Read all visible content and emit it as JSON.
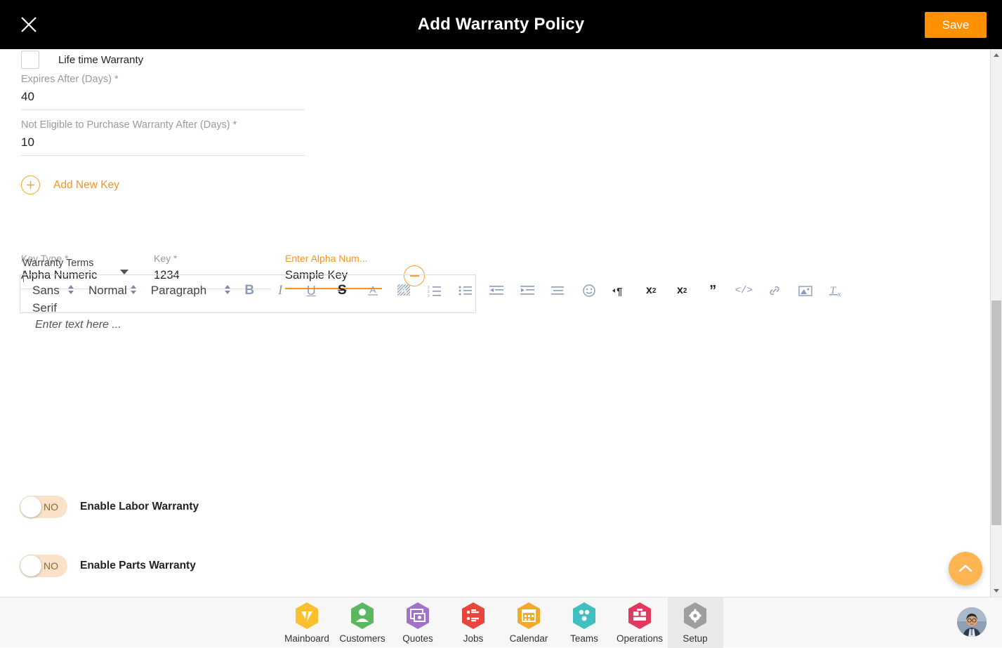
{
  "header": {
    "title": "Add Warranty Policy",
    "close_icon": "close-icon",
    "save_label": "Save"
  },
  "form": {
    "lifetime_warranty": {
      "label": "Life time Warranty",
      "checked": false
    },
    "expires_after": {
      "label": "Expires After (Days) *",
      "value": "40"
    },
    "not_eligible_after": {
      "label": "Not Eligible to Purchase Warranty After (Days) *",
      "value": "10"
    },
    "add_new_key": {
      "label": "Add New Key",
      "icon": "plus-circle-icon"
    },
    "key_row": {
      "key_type": {
        "label": "Key Type *",
        "value": "Alpha Numeric",
        "caret_icon": "chevron-down-icon"
      },
      "key": {
        "label": "Key *",
        "value": "1234"
      },
      "alpha": {
        "label": "Enter Alpha Num...",
        "value": "Sample Key"
      },
      "remove_icon": "minus-circle-icon"
    },
    "warranty_terms": {
      "label": "Warranty Terms",
      "placeholder": "Enter text here ...",
      "toolbar": {
        "font_family": "Sans Serif",
        "font_size": "Normal",
        "block_format": "Paragraph",
        "buttons": [
          {
            "name": "bold-icon",
            "glyph": "B",
            "style": "bold-g"
          },
          {
            "name": "italic-icon",
            "glyph": "I",
            "style": "italic-g"
          },
          {
            "name": "underline-icon",
            "glyph": "U",
            "style": "underline-g"
          },
          {
            "name": "strikethrough-icon",
            "glyph": "S",
            "style": "strike-g"
          },
          {
            "name": "text-color-icon",
            "glyph": "A",
            "style": "color-g"
          },
          {
            "name": "background-color-icon",
            "glyph": "A",
            "style": "bg-g"
          },
          {
            "name": "ordered-list-icon",
            "glyph": "",
            "style": "svg-g"
          },
          {
            "name": "bullet-list-icon",
            "glyph": "",
            "style": "svg-g"
          },
          {
            "name": "outdent-icon",
            "glyph": "",
            "style": "svg-g"
          },
          {
            "name": "indent-icon",
            "glyph": "",
            "style": "svg-g"
          },
          {
            "name": "align-icon",
            "glyph": "",
            "style": "svg-g"
          },
          {
            "name": "emoji-icon",
            "glyph": "",
            "style": "svg-g"
          },
          {
            "name": "text-direction-icon",
            "glyph": "",
            "style": "svg-g"
          },
          {
            "name": "subscript-icon",
            "glyph": "",
            "style": "svg-g"
          },
          {
            "name": "superscript-icon",
            "glyph": "",
            "style": "svg-g"
          },
          {
            "name": "blockquote-icon",
            "glyph": "",
            "style": "svg-g"
          },
          {
            "name": "code-block-icon",
            "glyph": "",
            "style": "svg-g"
          },
          {
            "name": "link-icon",
            "glyph": "",
            "style": "svg-g"
          },
          {
            "name": "image-icon",
            "glyph": "",
            "style": "svg-g"
          },
          {
            "name": "clear-format-icon",
            "glyph": "",
            "style": "svg-g"
          }
        ]
      }
    },
    "enable_labor_warranty": {
      "label": "Enable Labor Warranty",
      "state": "NO"
    },
    "enable_parts_warranty": {
      "label": "Enable Parts Warranty",
      "state": "NO"
    }
  },
  "fab": {
    "icon": "chevron-up-icon"
  },
  "bottom_nav": {
    "items": [
      {
        "label": "Mainboard",
        "icon": "mainboard-icon",
        "color": "#FBC02D",
        "active": false
      },
      {
        "label": "Customers",
        "icon": "customers-icon",
        "color": "#5CB860",
        "active": false
      },
      {
        "label": "Quotes",
        "icon": "quotes-icon",
        "color": "#A073C8",
        "active": false
      },
      {
        "label": "Jobs",
        "icon": "jobs-icon",
        "color": "#E8453C",
        "active": false
      },
      {
        "label": "Calendar",
        "icon": "calendar-icon",
        "color": "#F3A929",
        "active": false
      },
      {
        "label": "Teams",
        "icon": "teams-icon",
        "color": "#3FBFBF",
        "active": false
      },
      {
        "label": "Operations",
        "icon": "operations-icon",
        "color": "#E03A5F",
        "active": false
      },
      {
        "label": "Setup",
        "icon": "setup-icon",
        "color": "#9E9E9E",
        "active": true
      }
    ],
    "avatar": "user-avatar"
  },
  "colors": {
    "accent_orange": "#f7941e",
    "save_orange": "#ff9000",
    "header_black": "#000000",
    "toolbar_icon": "#8b9ab8"
  }
}
